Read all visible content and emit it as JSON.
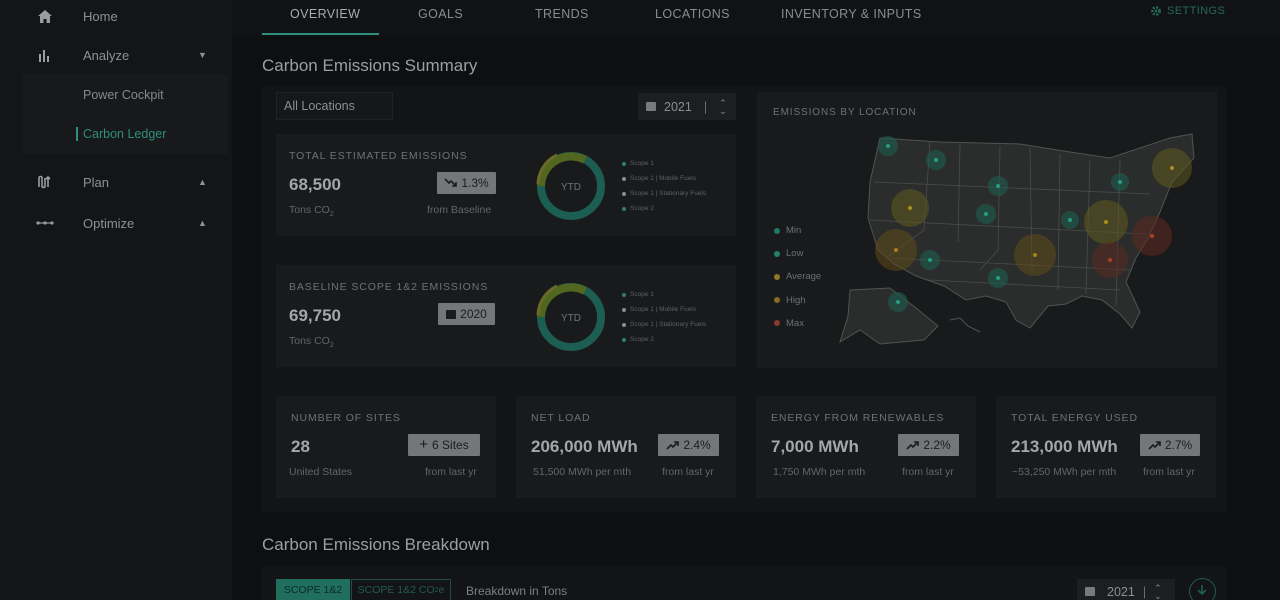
{
  "sidebar": {
    "items": [
      {
        "label": "Home",
        "icon": "home-icon"
      },
      {
        "label": "Analyze",
        "icon": "bar-chart-icon"
      },
      {
        "label": "Plan",
        "icon": "plan-icon"
      },
      {
        "label": "Optimize",
        "icon": "optimize-icon"
      }
    ],
    "sub_items": [
      {
        "label": "Power Cockpit"
      },
      {
        "label": "Carbon Ledger",
        "active": true
      }
    ]
  },
  "nav": {
    "tabs": [
      "OVERVIEW",
      "GOALS",
      "TRENDS",
      "LOCATIONS",
      "INVENTORY & INPUTS"
    ],
    "active_tab": "OVERVIEW",
    "settings_label": "SETTINGS"
  },
  "summary": {
    "title": "Carbon Emissions Summary",
    "location_select": "All Locations",
    "year_select": "2021",
    "total": {
      "caption": "TOTAL ESTIMATED EMISSIONS",
      "value": "68,500",
      "unit": "Tons CO",
      "unit_sub": "2",
      "badge": "1.3%",
      "badge_note": "from Baseline",
      "donut_label": "YTD"
    },
    "baseline": {
      "caption": "BASELINE SCOPE 1&2 EMISSIONS",
      "value": "69,750",
      "unit": "Tons CO",
      "unit_sub": "2",
      "badge": "2020",
      "donut_label": "YTD"
    },
    "donut_legend": [
      "Scope 1",
      "Scope 1 | Mobile Fuels",
      "Scope 1 | Stationary Fuels",
      "Scope 2"
    ],
    "map": {
      "caption": "EMISSIONS BY LOCATION",
      "legend": [
        {
          "label": "Min",
          "color": "#1e7a68"
        },
        {
          "label": "Low",
          "color": "#24806b"
        },
        {
          "label": "Average",
          "color": "#8a7a2a"
        },
        {
          "label": "High",
          "color": "#8a6a22"
        },
        {
          "label": "Max",
          "color": "#8a3a2a"
        }
      ]
    },
    "kpis": [
      {
        "caption": "NUMBER OF SITES",
        "value": "28",
        "sub": "United States",
        "badge": "6 Sites",
        "note": "from last yr",
        "badge_icon": "plus-icon"
      },
      {
        "caption": "NET LOAD",
        "value": "206,000 MWh",
        "sub": "51,500 MWh per mth",
        "badge": "2.4%",
        "note": "from last yr",
        "badge_icon": "trend-up-icon"
      },
      {
        "caption": "ENERGY FROM RENEWABLES",
        "value": "7,000 MWh",
        "sub": "1,750 MWh per mth",
        "badge": "2.2%",
        "note": "from last yr",
        "badge_icon": "trend-up-icon"
      },
      {
        "caption": "TOTAL ENERGY USED",
        "value": "213,000 MWh",
        "sub": "~53,250 MWh per mth",
        "badge": "2.7%",
        "note": "from last yr",
        "badge_icon": "trend-up-icon"
      }
    ]
  },
  "breakdown": {
    "title": "Carbon Emissions Breakdown",
    "tab_scope": "SCOPE 1&2",
    "tab_co2": "SCOPE 1&2 CO",
    "tab_co2_sub": "2",
    "tab_co2_suffix": "e",
    "label": "Breakdown in Tons",
    "year_select": "2021"
  },
  "colors": {
    "accent": "#2f8f7c",
    "panel": "#131415",
    "card": "#191a1b"
  }
}
